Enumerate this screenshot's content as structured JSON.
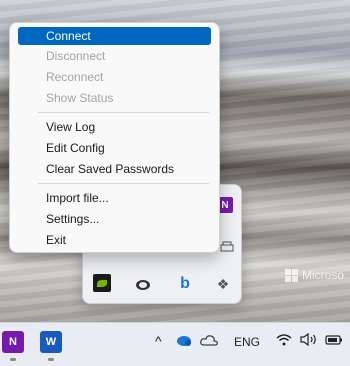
{
  "menu": {
    "items": [
      {
        "label": "Connect",
        "state": "selected"
      },
      {
        "label": "Disconnect",
        "state": "disabled"
      },
      {
        "label": "Reconnect",
        "state": "disabled"
      },
      {
        "label": "Show Status",
        "state": "disabled"
      },
      {
        "label": "View Log",
        "state": "normal"
      },
      {
        "label": "Edit Config",
        "state": "normal"
      },
      {
        "label": "Clear Saved Passwords",
        "state": "normal"
      },
      {
        "label": "Import file...",
        "state": "normal"
      },
      {
        "label": "Settings...",
        "state": "normal"
      },
      {
        "label": "Exit",
        "state": "normal"
      }
    ]
  },
  "tray_flyout": {
    "icons": [
      "onenote-icon",
      "printer-icon",
      "nvidia-icon",
      "cloud-sync-icon",
      "bing-icon",
      "dropbox-icon"
    ]
  },
  "watermark": {
    "text": "Microso"
  },
  "taskbar": {
    "apps": [
      {
        "name": "onenote",
        "glyph": "N"
      },
      {
        "name": "word",
        "glyph": "W"
      }
    ],
    "tray": {
      "chevron": "^",
      "language": "ENG"
    }
  },
  "colors": {
    "accent": "#0067c0",
    "onenote": "#7719aa",
    "word": "#185abd"
  }
}
